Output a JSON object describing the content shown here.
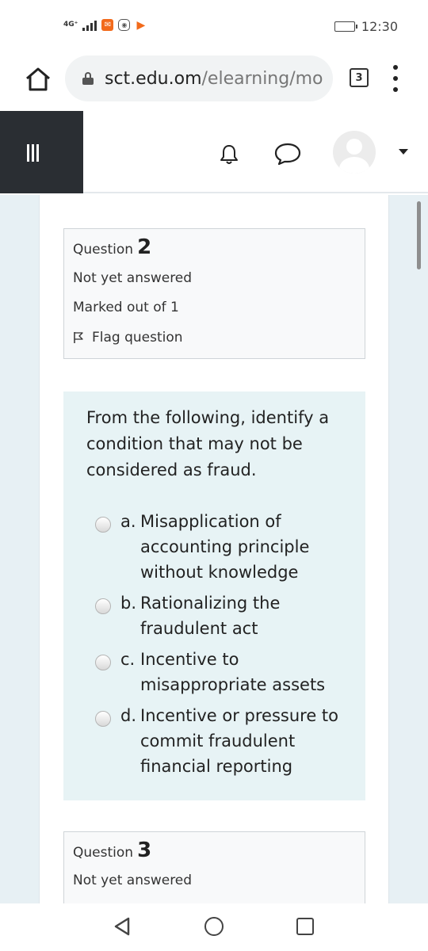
{
  "status_bar": {
    "network": "4G⁺",
    "time": "12:30"
  },
  "browser": {
    "url_domain": "sct.edu.om",
    "url_path": "/elearning/mo",
    "tab_count": "3"
  },
  "question2": {
    "label": "Question",
    "number": "2",
    "state": "Not yet answered",
    "marks": "Marked out of 1",
    "flag_label": "Flag question",
    "text": "From the following, identify a condition that may not be considered as fraud.",
    "options": [
      {
        "prefix": "a.",
        "text": "Misapplication of accounting principle without knowledge"
      },
      {
        "prefix": "b.",
        "text": "Rationalizing the fraudulent act"
      },
      {
        "prefix": "c.",
        "text": "Incentive to misappropriate assets"
      },
      {
        "prefix": "d.",
        "text": "Incentive or pressure to commit fraudulent financial reporting"
      }
    ]
  },
  "question3": {
    "label": "Question",
    "number": "3",
    "state": "Not yet answered"
  },
  "icons": {
    "home": "home-icon",
    "lock": "lock-icon",
    "menu": "more-vert-icon",
    "drawer": "hamburger-icon",
    "notifications": "bell-icon",
    "messages": "chat-bubble-icon",
    "user": "avatar-icon",
    "flag": "flag-icon"
  },
  "colors": {
    "drawer_bg": "#2a2e33",
    "question_text_bg": "#e7f3f5",
    "info_box_bg": "#f8f9fa",
    "page_bg": "#e7f0f4"
  }
}
